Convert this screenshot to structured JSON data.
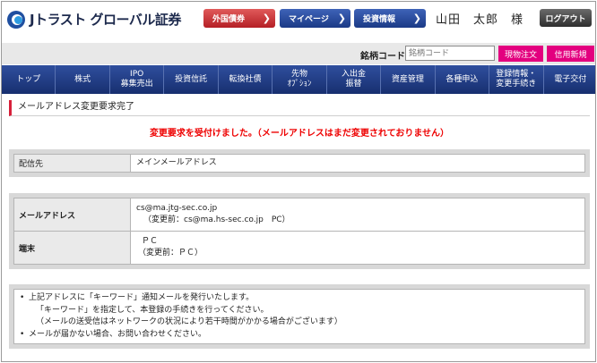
{
  "header": {
    "logo_text": "Jトラスト グローバル証券",
    "btn_foreign": "外国債券",
    "btn_mypage": "マイページ",
    "btn_invest": "投資情報",
    "user_name": "山田　太郎　様",
    "logout": "ログアウト"
  },
  "search": {
    "label": "銘柄コード",
    "placeholder": "銘柄コード",
    "btn_spot": "現物注文",
    "btn_margin": "信用新規"
  },
  "nav": {
    "items": [
      "トップ",
      "株式",
      "IPO\n募集売出",
      "投資信託",
      "転換社債",
      "先物\nｵﾌﾟｼｮﾝ",
      "入出金\n振替",
      "資産管理",
      "各種申込",
      "登録情報・\n変更手続き",
      "電子交付"
    ]
  },
  "page": {
    "title": "メールアドレス変更要求完了",
    "notice": "変更要求を受付けました。（メールアドレスはまだ変更されておりません）"
  },
  "delivery": {
    "label": "配信先",
    "value": "メインメールアドレス"
  },
  "details": {
    "email_label": "メールアドレス",
    "email_value": "cs@ma.jtg-sec.co.jp",
    "email_prev": "（変更前：cs@ma.hs-sec.co.jp　PC）",
    "device_label": "端末",
    "device_value": "ＰＣ",
    "device_prev": "（変更前：ＰＣ）"
  },
  "info": {
    "line1": "上記アドレスに「キーワード」通知メールを発行いたします。",
    "line2": "「キーワード」を指定して、本登録の手続きを行ってください。",
    "line3": "（メールの送受信はネットワークの状況により若干時間がかかる場合がございます）",
    "line4": "メールが届かない場合、お問い合わせください。"
  }
}
